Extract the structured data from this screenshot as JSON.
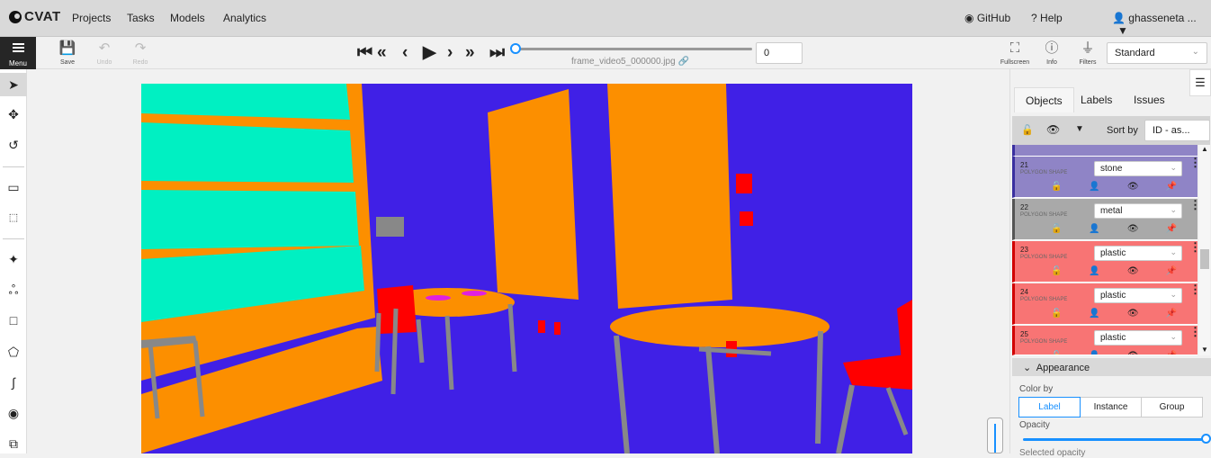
{
  "header": {
    "logo": "CVAT",
    "nav": [
      "Projects",
      "Tasks",
      "Models",
      "Analytics"
    ],
    "github": "GitHub",
    "help": "Help",
    "user": "ghasseneta ..."
  },
  "toolbar": {
    "menu_label": "Menu",
    "save_label": "Save",
    "undo_label": "Undo",
    "redo_label": "Redo",
    "frame_value": "0",
    "filename": "frame_video5_000000.jpg",
    "fullscreen_label": "Fullscreen",
    "info_label": "Info",
    "filters_label": "Filters",
    "workspace_value": "Standard"
  },
  "sidebar": {
    "tabs": [
      "Objects",
      "Labels",
      "Issues"
    ],
    "sort_label": "Sort by",
    "sort_value": "ID - as...",
    "objects": [
      {
        "id": "21",
        "type": "POLYGON SHAPE",
        "label": "stone",
        "color": "#8f84c6"
      },
      {
        "id": "22",
        "type": "POLYGON SHAPE",
        "label": "metal",
        "color": "#a9a9a9"
      },
      {
        "id": "23",
        "type": "POLYGON SHAPE",
        "label": "plastic",
        "color": "#f87474"
      },
      {
        "id": "24",
        "type": "POLYGON SHAPE",
        "label": "plastic",
        "color": "#f87474"
      },
      {
        "id": "25",
        "type": "POLYGON SHAPE",
        "label": "plastic",
        "color": "#f87474"
      }
    ],
    "appearance": {
      "title": "Appearance",
      "color_by_label": "Color by",
      "color_by_options": [
        "Label",
        "Instance",
        "Group"
      ],
      "opacity_label": "Opacity",
      "selected_opacity_label": "Selected opacity"
    }
  }
}
